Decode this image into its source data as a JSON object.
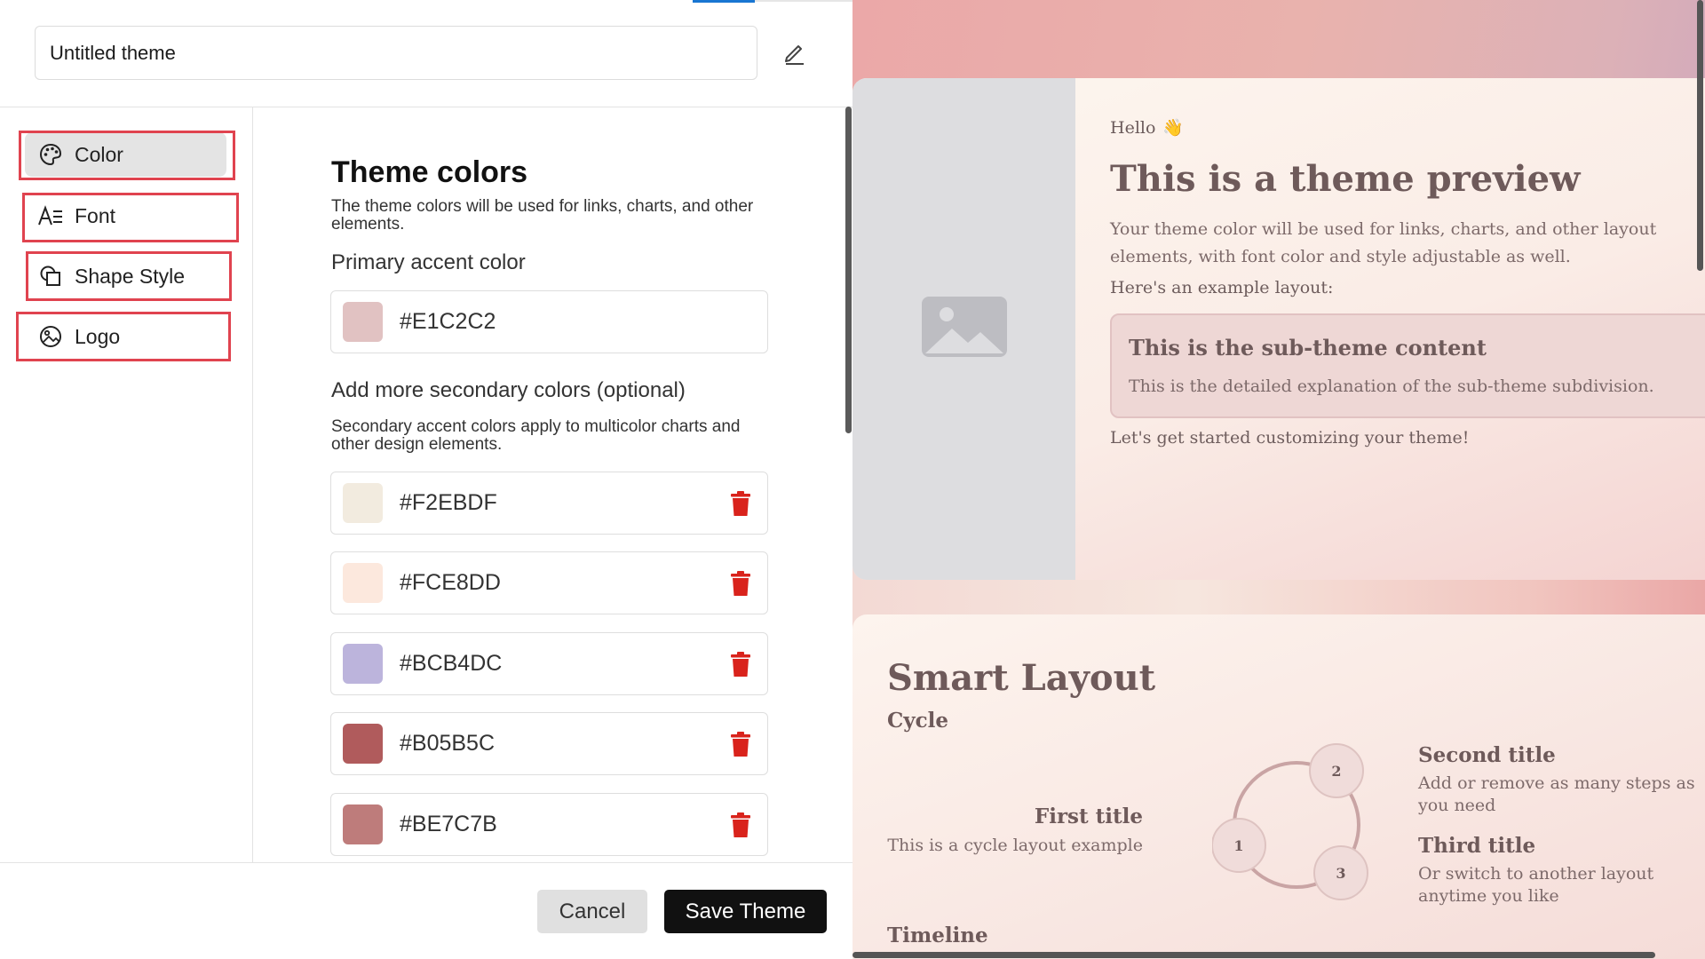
{
  "editor": {
    "theme_name": "Untitled theme",
    "sidebar": {
      "items": [
        {
          "label": "Color",
          "icon": "palette-icon"
        },
        {
          "label": "Font",
          "icon": "font-icon"
        },
        {
          "label": "Shape Style",
          "icon": "shape-icon"
        },
        {
          "label": "Logo",
          "icon": "logo-icon"
        }
      ],
      "active": "Color"
    },
    "section": {
      "title": "Theme colors",
      "description": "The theme colors will be used for links, charts, and other elements.",
      "primary_label": "Primary accent color",
      "primary_color": {
        "hex": "#E1C2C2",
        "swatch": "#E1C2C2"
      },
      "secondary_label": "Add more secondary colors (optional)",
      "secondary_description": "Secondary accent colors apply to multicolor charts and other design elements.",
      "secondary_colors": [
        {
          "hex": "#F2EBDF",
          "swatch": "#F2EBDF"
        },
        {
          "hex": "#FCE8DD",
          "swatch": "#FCE8DD"
        },
        {
          "hex": "#BCB4DC",
          "swatch": "#BCB4DC"
        },
        {
          "hex": "#B05B5C",
          "swatch": "#B05B5C"
        },
        {
          "hex": "#BE7C7B",
          "swatch": "#BE7C7B"
        }
      ]
    },
    "footer": {
      "cancel_label": "Cancel",
      "save_label": "Save Theme"
    },
    "colors": {
      "highlight": "#e0434f",
      "trash": "#d9231c",
      "accent_tab": "#1976d2"
    }
  },
  "preview": {
    "card1": {
      "hello": "Hello",
      "hello_emoji": "👋",
      "title": "This is a theme preview",
      "body": "Your theme color will be used for links, charts, and other layout elements, with font color and style adjustable as well.",
      "example_label": "Here's an example layout:",
      "subtheme_title": "This is the sub-theme content",
      "subtheme_body": "This is the detailed explanation of the sub-theme subdivision.",
      "started": "Let's get started customizing your theme!"
    },
    "card2": {
      "title": "Smart Layout",
      "cycle_label": "Cycle",
      "first_title": "First title",
      "first_body": "This is a cycle layout example",
      "second_title": "Second title",
      "second_body": "Add or remove as many steps as you need",
      "third_title": "Third title",
      "third_body": "Or switch to another layout anytime you like",
      "step_numbers": [
        "1",
        "2",
        "3"
      ],
      "timeline_label": "Timeline"
    }
  }
}
